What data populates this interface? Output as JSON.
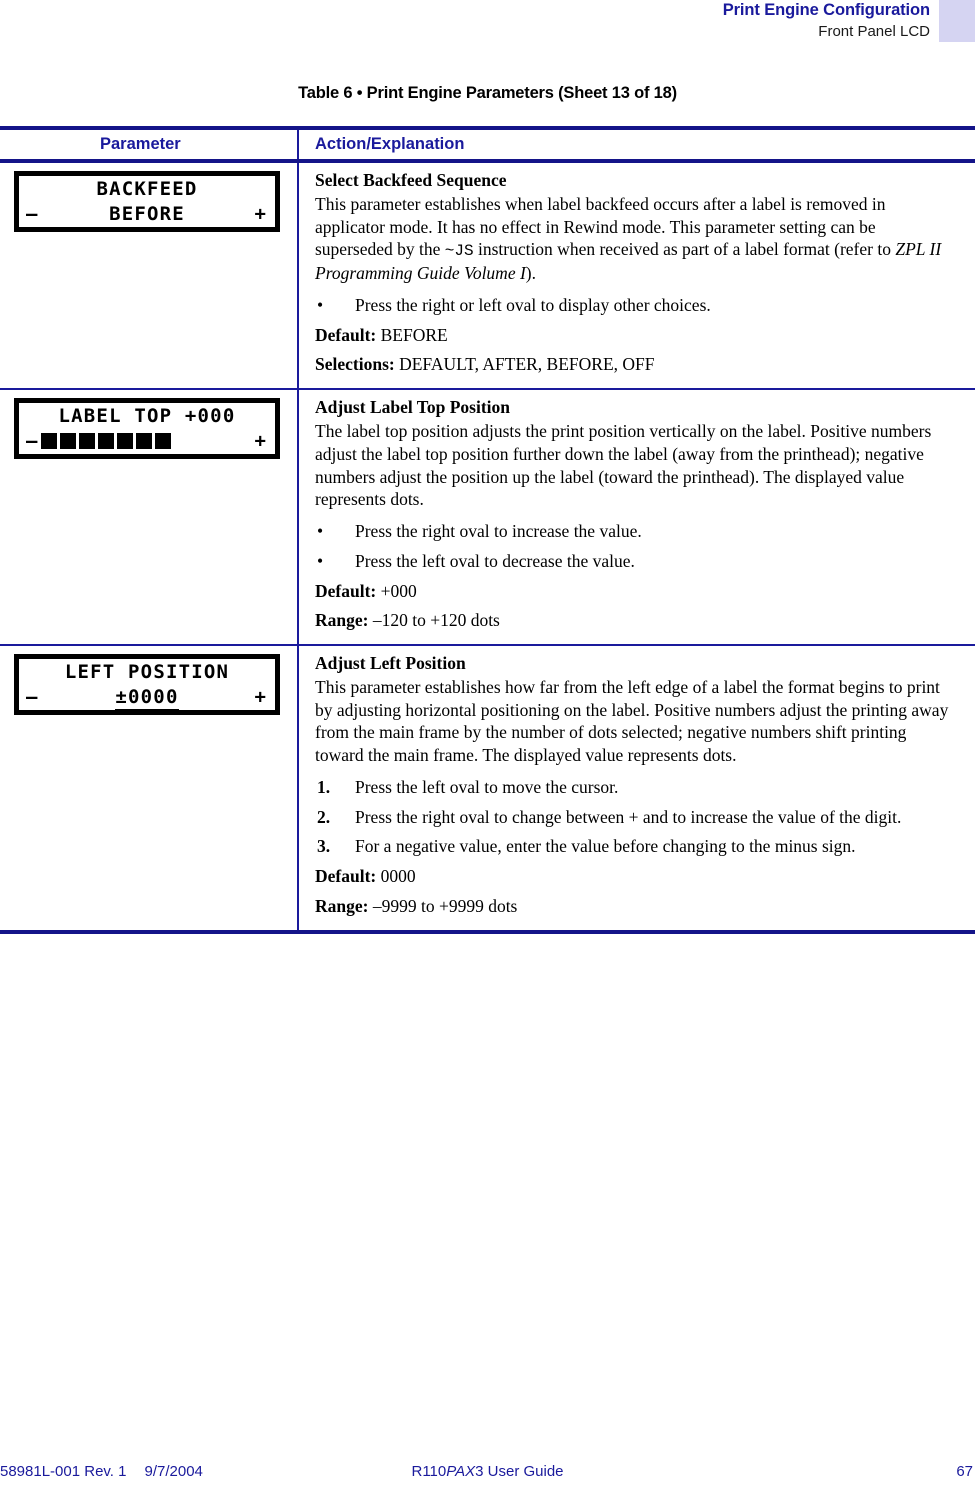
{
  "header": {
    "title": "Print Engine Configuration",
    "subtitle": "Front Panel LCD",
    "swatch_color": "#d5d4f2",
    "accent_color": "#1a1a9c"
  },
  "table_caption": "Table 6 • Print Engine Parameters (Sheet 13 of 18)",
  "columns": {
    "parameter": "Parameter",
    "action": "Action/Explanation"
  },
  "rows": [
    {
      "lcd": {
        "line1": "BACKFEED",
        "line2": "BEFORE",
        "minus": "–",
        "plus": "+",
        "type": "text"
      },
      "heading": "Select Backfeed Sequence",
      "paragraph_pre": "This parameter establishes when label backfeed occurs after a label is removed in applicator mode. It has no effect in Rewind mode. This parameter setting can be superseded by the ",
      "paragraph_code": "~JS",
      "paragraph_mid": " instruction when received as part of a label format (refer to ",
      "paragraph_italic": "ZPL II Programming Guide Volume I",
      "paragraph_post": ").",
      "bullets": [
        "Press the right or left oval to display other choices."
      ],
      "default_label": "Default:",
      "default_value": "BEFORE",
      "selections_label": "Selections:",
      "selections_value": "DEFAULT, AFTER, BEFORE, OFF"
    },
    {
      "lcd": {
        "line1": "LABEL TOP +000",
        "minus": "–",
        "plus": "+",
        "type": "bargraph",
        "blocks": 7
      },
      "heading": "Adjust Label Top Position",
      "paragraph": "The label top position adjusts the print position vertically on the label. Positive numbers adjust the label top position further down the label (away from the printhead); negative numbers adjust the position up the label (toward the printhead). The displayed value represents dots.",
      "bullets": [
        "Press the right oval to increase the value.",
        "Press the left oval to decrease the value."
      ],
      "default_label": "Default:",
      "default_value": "+000",
      "range_label": "Range:",
      "range_value": "–120 to +120 dots"
    },
    {
      "lcd": {
        "line1": "LEFT POSITION",
        "line2": "±0000",
        "minus": "–",
        "plus": "+",
        "type": "cursor-value"
      },
      "heading": "Adjust Left Position",
      "paragraph": "This parameter establishes how far from the left edge of a label the format begins to print by adjusting horizontal positioning on the label. Positive numbers adjust the printing away from the main frame by the number of dots selected; negative numbers shift printing toward the main frame. The displayed value represents dots.",
      "steps": [
        {
          "num": "1.",
          "text": "Press the left oval to move the cursor."
        },
        {
          "num": "2.",
          "text": "Press the right oval to change between + and to increase the value of the digit."
        },
        {
          "num": "3.",
          "text": "For a negative value, enter the value before changing to the minus sign."
        }
      ],
      "default_label": "Default:",
      "default_value": "0000",
      "range_label": "Range:",
      "range_value": "–9999 to +9999 dots"
    }
  ],
  "footer": {
    "doc_id": "58981L-001 Rev. 1",
    "date": "9/7/2004",
    "guide_pre": "R110",
    "guide_italic": "PAX",
    "guide_post": "3 User Guide",
    "page_number": "67"
  }
}
